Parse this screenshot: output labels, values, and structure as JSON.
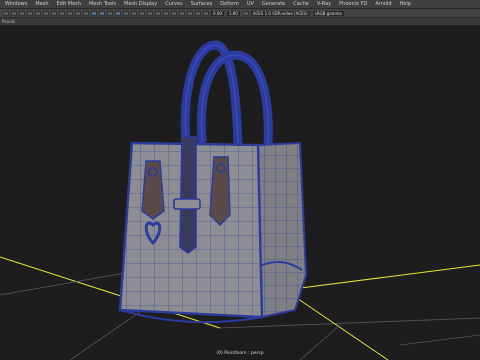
{
  "app": {
    "menu": [
      "Windows",
      "Mesh",
      "Edit Mesh",
      "Mesh Tools",
      "Mesh Display",
      "Curves",
      "Surfaces",
      "Deform",
      "UV",
      "Generate",
      "Cache",
      "V-Ray",
      "Phoenix FD",
      "Arnold",
      "Help"
    ]
  },
  "toolbar": {
    "exposure": "0.00",
    "gamma": "1.00",
    "colorspace": "sRGB gamma",
    "view_transform": "ACES 1.0 SDR-video (ACES)"
  },
  "panel": {
    "menu_label": "Panels"
  },
  "viewport": {
    "camera_label": "(0) Pointloom : persp",
    "colors": {
      "background": "#1d1d1d",
      "grid_axis": "#e6e63a",
      "mesh_fill": "#8d8d94",
      "wire": "#2c3b9c",
      "wire_highlight": "#3a4cc8"
    }
  }
}
